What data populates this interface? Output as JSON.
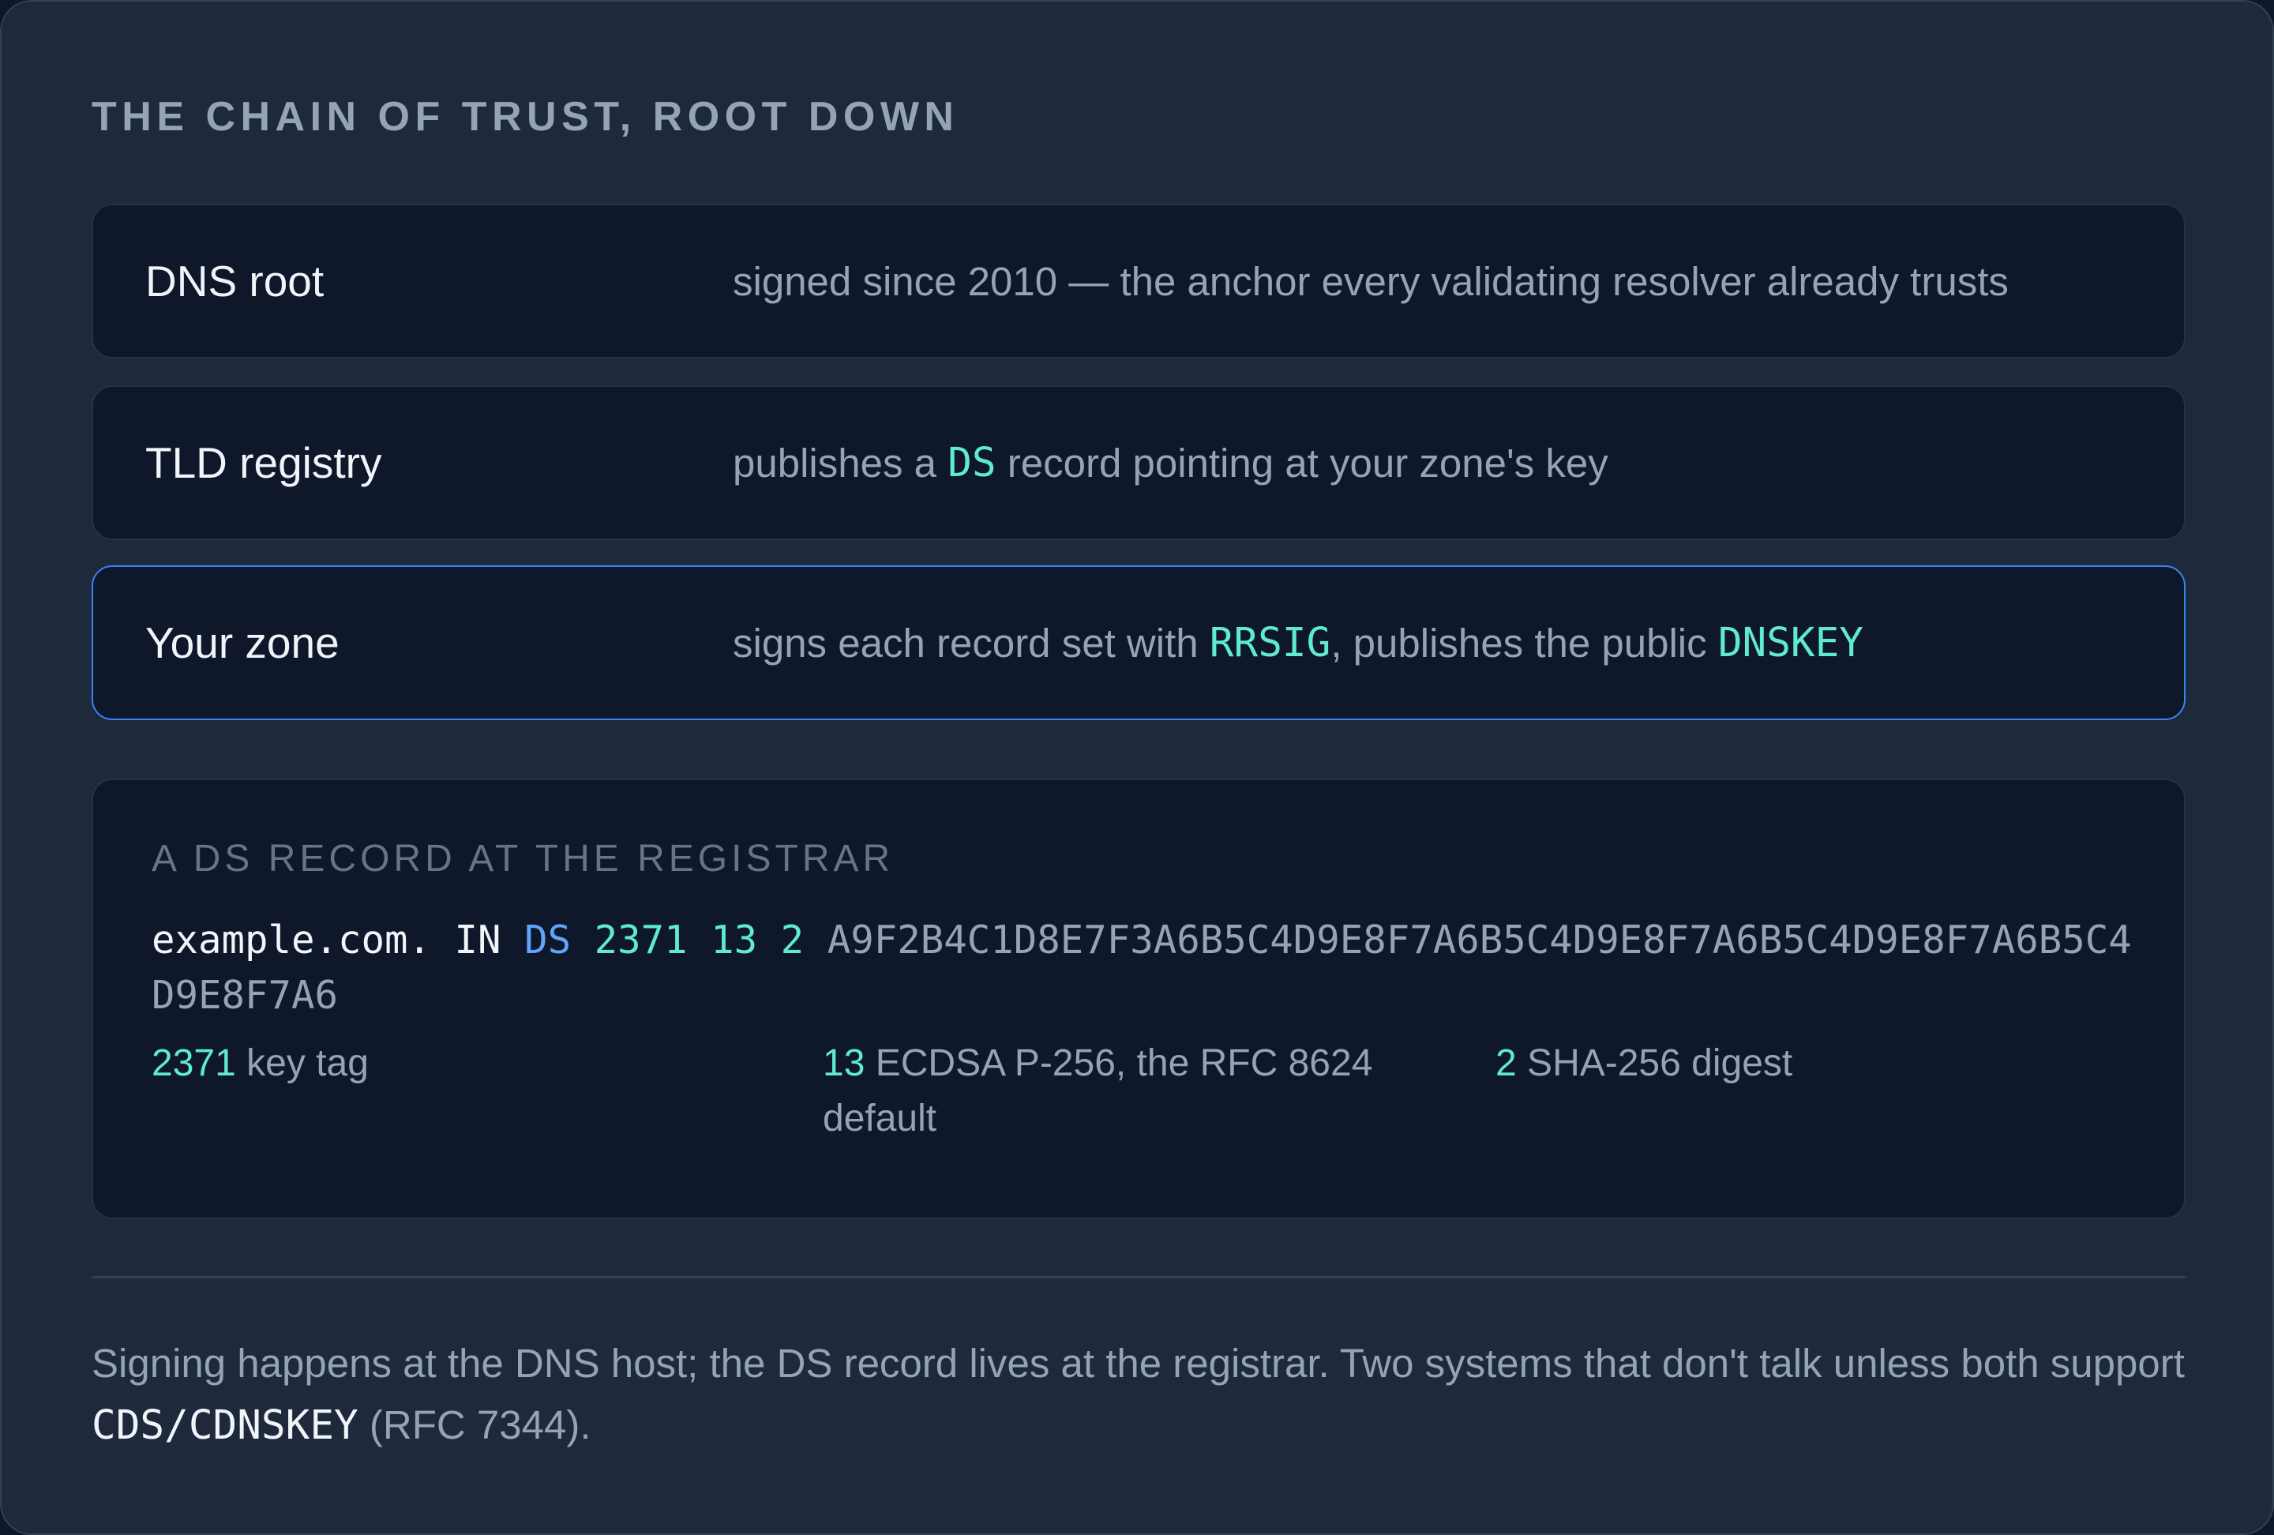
{
  "heading": "THE CHAIN OF TRUST, ROOT DOWN",
  "chain": [
    {
      "name": "DNS root",
      "desc": "signed since 2010 — the anchor every validating resolver already trusts"
    },
    {
      "name": "TLD registry",
      "desc_pre": "publishes a ",
      "desc_code": "DS",
      "desc_post": " record pointing at your zone's key"
    },
    {
      "name": "Your zone",
      "desc_pre": "signs each record set with ",
      "desc_code1": "RRSIG",
      "desc_mid": ", publishes the public ",
      "desc_code2": "DNSKEY",
      "highlighted": true
    }
  ],
  "ds_record": {
    "title": "A DS RECORD AT THE REGISTRAR",
    "owner": "example.com.",
    "class": "IN",
    "type": "DS",
    "key_tag": "2371",
    "algorithm": "13",
    "digest_type": "2",
    "digest": "A9F2B4C1D8E7F3A6B5C4D9E8F7A6B5C4D9E8F7A6B5C4D9E8F7A6B5C4D9E8F7A6",
    "legend": [
      {
        "value": "2371",
        "label": "key tag"
      },
      {
        "value": "13",
        "label": "ECDSA P-256, the RFC 8624 default"
      },
      {
        "value": "2",
        "label": "SHA-256 digest"
      }
    ]
  },
  "footer": {
    "text_pre": "Signing happens at the DNS host; the DS record lives at the registrar. Two systems that don't talk unless both support ",
    "code": "CDS/CDNSKEY",
    "text_post": " (RFC 7344)."
  },
  "colors": {
    "background": "#1e293b",
    "row_background": "#0f172a",
    "accent_teal": "#5eead4",
    "accent_blue": "#60a5fa",
    "highlight_border": "#3b82f6"
  }
}
